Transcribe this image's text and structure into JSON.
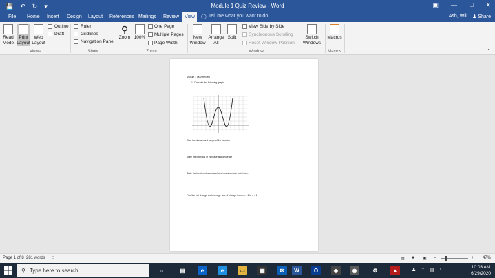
{
  "title_bar": {
    "title": "Module 1 Quiz Review - Word",
    "qat": [
      "save-icon",
      "undo-icon",
      "redo-icon",
      "customize-icon"
    ]
  },
  "tabs": [
    {
      "label": "File"
    },
    {
      "label": "Home"
    },
    {
      "label": "Insert"
    },
    {
      "label": "Design"
    },
    {
      "label": "Layout"
    },
    {
      "label": "References"
    },
    {
      "label": "Mailings"
    },
    {
      "label": "Review"
    },
    {
      "label": "View",
      "active": true
    }
  ],
  "tell_me": "Tell me what you want to do...",
  "user": "Ash, Will",
  "share": "Share",
  "ribbon": {
    "views": {
      "label": "Views",
      "read_mode": [
        "Read",
        "Mode"
      ],
      "print_layout": [
        "Print",
        "Layout"
      ],
      "web_layout": [
        "Web",
        "Layout"
      ],
      "outline": "Outline",
      "draft": "Draft"
    },
    "show": {
      "label": "Show",
      "ruler": "Ruler",
      "gridlines": "Gridlines",
      "nav_pane": "Navigation Pane"
    },
    "zoom": {
      "label": "Zoom",
      "zoom": "Zoom",
      "hundred": "100%",
      "one_page": "One Page",
      "multiple_pages": "Multiple Pages",
      "page_width": "Page Width"
    },
    "window": {
      "label": "Window",
      "new_window": [
        "New",
        "Window"
      ],
      "arrange_all": [
        "Arrange",
        "All"
      ],
      "split": "Split",
      "side_by_side": "View Side by Side",
      "sync_scroll": "Synchronous Scrolling",
      "reset_pos": "Reset Window Position",
      "switch_windows": [
        "Switch",
        "Windows"
      ]
    },
    "macros": {
      "label": "Macros",
      "macros": "Macros"
    }
  },
  "document": {
    "header": "Module 1 Quiz Review",
    "q1": "1)   Consider the following graph",
    "q_domain": "Give the domain and range of the function",
    "q_intervals": "State the intervals of increase and decrease",
    "q_local": "State the local minimums and local maximums in point form",
    "q_rate": "Find the net change and average rate of change from x = −2 to x = 1"
  },
  "status": {
    "page": "Page 1 of 8",
    "words": "281 words",
    "zoom": "47%"
  },
  "taskbar": {
    "search_placeholder": "Type here to search",
    "time": "10:03 AM",
    "date": "6/29/2020"
  }
}
